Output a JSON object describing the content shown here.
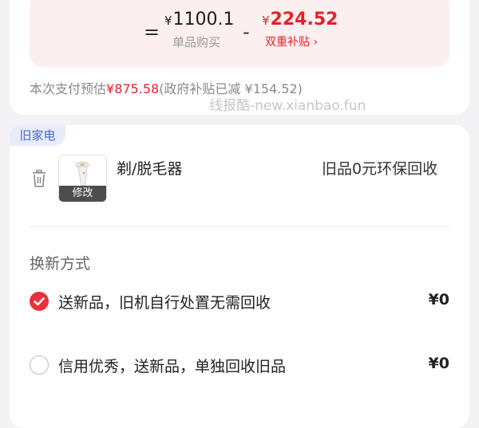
{
  "pricing": {
    "equals": "=",
    "unit_price": "1100.1",
    "unit_currency": "¥",
    "unit_label": "单品购买",
    "minus": "-",
    "subsidy_price": "224.52",
    "subsidy_currency": "¥",
    "subsidy_label": "双重补贴 ›",
    "estimate_prefix": "本次支付预估",
    "estimate_amount": "¥875.58",
    "estimate_suffix": "(政府补贴已减 ¥154.52)"
  },
  "watermark": "线报酷-new.xianbao.fun",
  "old_appliance": {
    "tag": "旧家电",
    "edit_label": "修改",
    "product_name": "剃/脱毛器",
    "recycle_text": "旧品0元环保回收"
  },
  "trade_in": {
    "title": "换新方式",
    "options": [
      {
        "label": "送新品，旧机自行处置无需回收",
        "price": "¥0",
        "selected": true
      },
      {
        "label": "信用优秀，送新品，单独回收旧品",
        "price": "¥0",
        "selected": false
      }
    ]
  },
  "colors": {
    "accent_red": "#e2232a",
    "tag_blue": "#4a67c9",
    "price_box_bg": "#fcefef"
  }
}
